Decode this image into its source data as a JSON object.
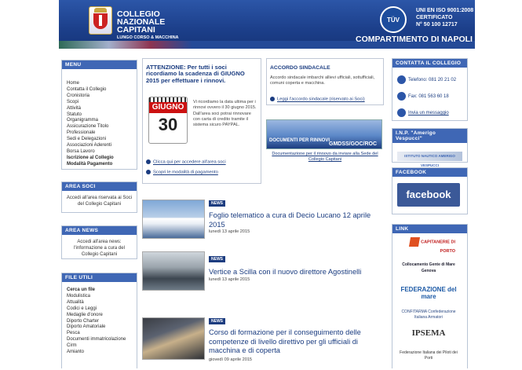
{
  "header": {
    "title_line1": "COLLEGIO",
    "title_line2": "NAZIONALE",
    "title_line3": "CAPITANI",
    "subtitle": "LUNGO CORSO & MACCHINA",
    "tuv": "TÜV",
    "iso_line1": "UNI EN ISO 9001:2008",
    "iso_line2": "CERTIFICATO",
    "iso_line3": "N° 50 100 12717",
    "compartimento": "COMPARTIMENTO DI NAPOLI"
  },
  "menu": {
    "heading": "MENU",
    "items": [
      "Home",
      "Contatta il Collegio",
      "Cronistoria",
      "Scopi",
      "Attività",
      "Statuto",
      "Organigramma",
      "Assicurazione Titolo Professionale",
      "Sedi e Delegazioni",
      "Associazioni Aderenti",
      "Borsa Lavoro",
      "Iscrizione al Collegio",
      "Modalità Pagamento"
    ]
  },
  "area_soci": {
    "heading": "AREA SOCI",
    "text": "Accedi all'area riservata ai Soci del Collegio Capitani"
  },
  "area_news": {
    "heading": "AREA NEWS",
    "text": "Accedi all'area news: l'informazione a cura del Collegio Capitani"
  },
  "file_utili": {
    "heading": "FILE UTILI",
    "items": [
      "Cerca un file",
      "Modulistica",
      "Attualità",
      "Codici e Leggi",
      "Medaglie d'onore",
      "Diporto Charter",
      "Diporto Amatoriale",
      "Pesca",
      "Documenti immatricolazione",
      "Cirm",
      "Amianto"
    ]
  },
  "attenzione": {
    "title": "ATTENZIONE: Per tutti i soci ricordiamo la scadenza di GIUGNO 2015 per effettuare i rinnovi.",
    "cal_month": "GIUGNO",
    "cal_day": "30",
    "text": "Vi ricordiamo la data ultima per i rinnovi ovvero il 30 giugno 2015. Dall'area soci potrai rinnovare con carta di credito tramite il sistema sicuro PAYPAL.",
    "link1": "Clicca qui per accedere all'area soci",
    "link2": "Scopri le modalità di pagamento"
  },
  "accordo": {
    "title": "ACCORDO SINDACALE",
    "text": "Accordo sindacale imbarchi allievi ufficiali, sottufficiali, comuni coperta e macchina.",
    "link": "Leggi l'accordo sindacale (riservato ai Soci)"
  },
  "banner": {
    "line1": "DOCUMENTI PER RINNOVI",
    "line2": "GMDSS/GOC/ROC",
    "caption": "Documentazione per il rinnovo da inviare alla Sede del Collegio Capitani"
  },
  "news": [
    {
      "badge": "NEWS",
      "title": "Foglio telematico a cura di Decio Lucano 12 aprile 2015",
      "date": "lunedì 13 aprile 2015"
    },
    {
      "badge": "NEWS",
      "title": "Vertice a Scilla con il nuovo direttore Agostinelli",
      "date": "lunedì 13 aprile 2015"
    },
    {
      "badge": "NEWS",
      "title": "Corso di formazione per il conseguimento delle competenze di livello direttivo per gli ufficiali di macchina e di coperta",
      "date": "giovedì 09 aprile 2015"
    }
  ],
  "contatta": {
    "heading": "CONTATTA IL COLLEGIO",
    "telefono": "Telefono: 081 20 21 02",
    "fax": "Fax: 081 563 60 18",
    "email": "Invia un messaggio"
  },
  "inp": {
    "heading": "I.N.P. \"Amerigo Vespucci\"",
    "caption": "ISTITUTO NAUTICO AMERIGO VESPUCCI"
  },
  "facebook": {
    "heading": "FACEBOOK",
    "label": "facebook"
  },
  "link": {
    "heading": "LINK",
    "items": [
      "CAPITANERIE DI PORTO",
      "Collocamento Gente di Mare Genova",
      "FEDERAZIONE del mare",
      "CONFITARMA Confederazione Italiana Armatori",
      "IPSEMA",
      "Federazione Italiana dei Piloti dei Porti"
    ]
  },
  "colors": {
    "header": "#1c3f8a",
    "box_head": "#3f67b5",
    "link": "#1a3c80",
    "badge": "#1d3d80"
  }
}
